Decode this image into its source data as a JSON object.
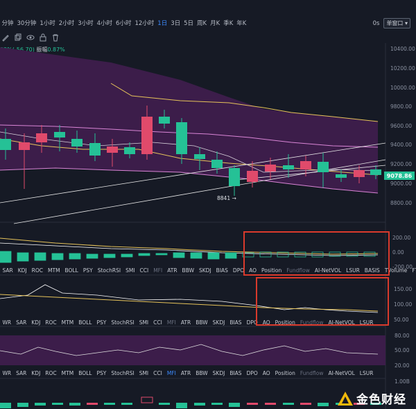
{
  "timeframes": [
    "分钟",
    "30分钟",
    "1小时",
    "2小时",
    "3小时",
    "4小时",
    "6小时",
    "12小时",
    "1日",
    "3日",
    "5日",
    "周K",
    "月K",
    "季K",
    "年K"
  ],
  "active_timeframe": "1日",
  "seconds_label": "0s",
  "window_button": "单窗口",
  "info_line": {
    "change": "82%(-56.70)",
    "amp_label": "振幅",
    "amp_value": "0.87%"
  },
  "main_axis_ticks": [
    "10400.00",
    "10200.00",
    "10000.00",
    "9800.00",
    "9600.00",
    "9400.00",
    "9200.00",
    "9000.00",
    "8800.00"
  ],
  "current_price": "9078.86",
  "low_annotation": "8841",
  "panel1_ticks": [
    "200.00",
    "0.00",
    "-200.00"
  ],
  "panel1_indicators": [
    "SAR",
    "KDJ",
    "ROC",
    "MTM",
    "BOLL",
    "PSY",
    "StochRSI",
    "SMI",
    "CCI",
    "MFI",
    "ATR",
    "BBW",
    "SKDJ",
    "BIAS",
    "DPO",
    "AO",
    "Position",
    "Fundflow",
    "AI-NetVOL",
    "LSUR",
    "BASIS",
    "TVolume",
    "FTBS"
  ],
  "panel1_dim": [
    "MFI",
    "Fundflow"
  ],
  "panel2_ticks": [
    "150.00",
    "100.00",
    "50.00"
  ],
  "panel2_indicators": [
    "WR",
    "SAR",
    "KDJ",
    "ROC",
    "MTM",
    "BOLL",
    "PSY",
    "StochRSI",
    "SMI",
    "CCI",
    "MFI",
    "ATR",
    "BBW",
    "SKDJ",
    "BIAS",
    "DPO",
    "AO",
    "Position",
    "Fundflow",
    "AI-NetVOL",
    "LSUR"
  ],
  "panel2_dim": [
    "MFI",
    "Fundflow"
  ],
  "panel3_ticks": [
    "80.00",
    "50.00",
    "20.00"
  ],
  "panel3_indicators": [
    "WR",
    "SAR",
    "KDJ",
    "ROC",
    "MTM",
    "BOLL",
    "PSY",
    "StochRSI",
    "SMI",
    "CCI",
    "MFI",
    "ATR",
    "BBW",
    "SKDJ",
    "BIAS",
    "DPO",
    "AO",
    "Position",
    "Fundflow",
    "AI-NetVOL",
    "LSUR"
  ],
  "panel3_dim": [
    "Fundflow"
  ],
  "panel3_blue": [
    "MFI"
  ],
  "panel4_ticks": [
    "1.00B"
  ],
  "watermark_text": "金色财经",
  "colors": {
    "up": "#25c196",
    "down": "#e04a6b",
    "band": "#3c1d4a",
    "accent": "#3d8bff",
    "highlight": "#d93a2c"
  }
}
